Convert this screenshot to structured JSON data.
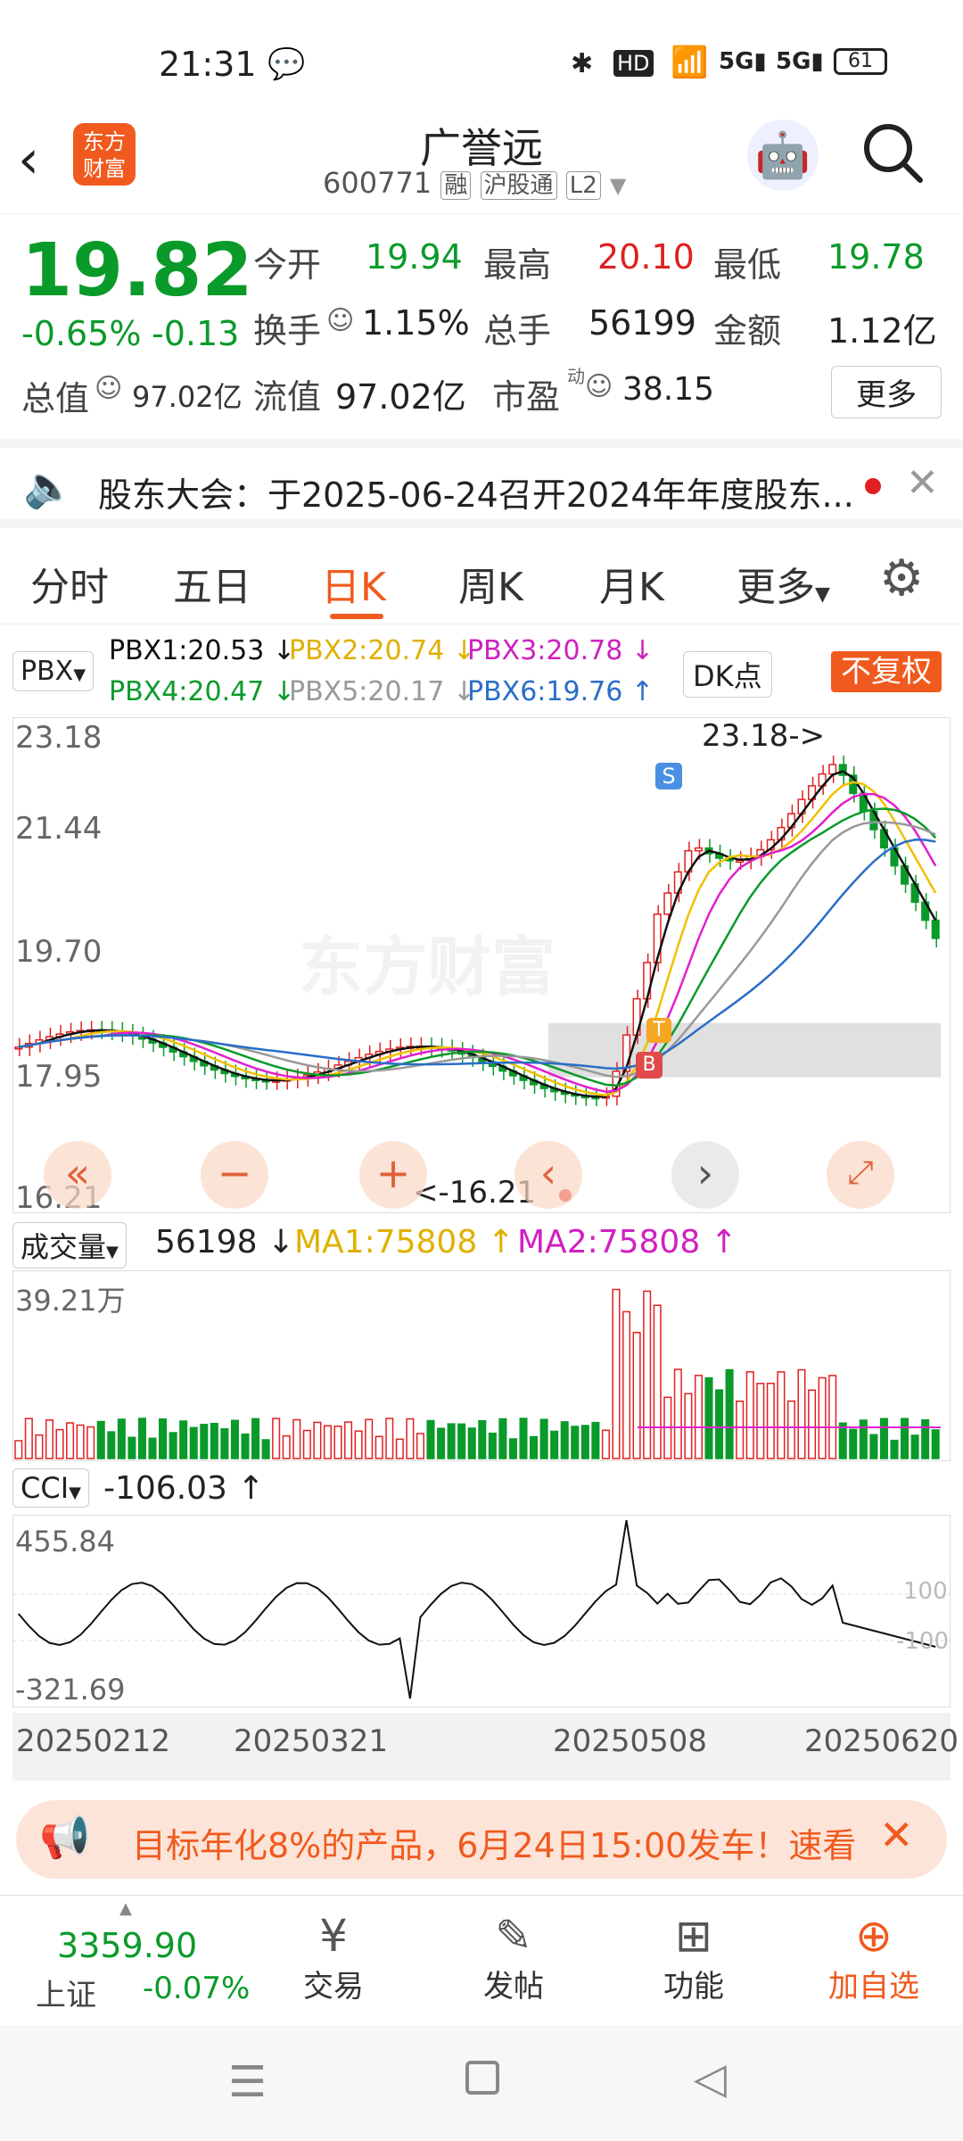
{
  "status_bar": {
    "time": "21:31",
    "battery": "61"
  },
  "header": {
    "app_logo_lines": [
      "东方",
      "财富"
    ],
    "stock_name": "广誉远",
    "stock_code": "600771",
    "badges": [
      "融",
      "沪股通",
      "L2"
    ]
  },
  "quote": {
    "price": "19.82",
    "change_pct": "-0.65%",
    "change_amt": "-0.13",
    "open_label": "今开",
    "open": "19.94",
    "high_label": "最高",
    "high": "20.10",
    "low_label": "最低",
    "low": "19.78",
    "turnover_label": "换手",
    "turnover": "1.15%",
    "volume_label": "总手",
    "volume": "56199",
    "amount_label": "金额",
    "amount": "1.12亿",
    "mktcap_label": "总值",
    "mktcap": "97.02亿",
    "float_label": "流值",
    "float": "97.02亿",
    "pe_label": "市盈",
    "pe_sup": "动",
    "pe": "38.15",
    "more_label": "更多"
  },
  "notice": {
    "text": "股东大会：于2025-06-24召开2024年年度股东..."
  },
  "tabs": [
    "分时",
    "五日",
    "日K",
    "周K",
    "月K",
    "更多"
  ],
  "active_tab": "日K",
  "kline": {
    "indicator": "PBX",
    "pbx1": "PBX1:20.53",
    "pbx2": "PBX2:20.74",
    "pbx3": "PBX3:20.78",
    "pbx4": "PBX4:20.47",
    "pbx5": "PBX5:20.17",
    "pbx6": "PBX6:19.76",
    "dk_label": "DK点",
    "fq_label": "不复权",
    "y_labels": [
      "23.18",
      "21.44",
      "19.70",
      "17.95",
      "16.21"
    ],
    "max_label": "23.18->",
    "min_label": "<-16.21",
    "markers": [
      "S",
      "T",
      "B"
    ],
    "watermark": "东方财富"
  },
  "volume": {
    "indicator": "成交量",
    "value": "56198",
    "ma1": "MA1:75808",
    "ma2": "MA2:75808",
    "ymax": "39.21万"
  },
  "cci": {
    "indicator": "CCI",
    "value": "-106.03",
    "ymax": "455.84",
    "ymin": "-321.69",
    "line_hi": "100",
    "line_lo": "-100"
  },
  "dates": [
    "20250212",
    "20250321",
    "20250508",
    "20250620"
  ],
  "ad": {
    "text": "目标年化8%的产品，6月24日15:00发车！速看"
  },
  "bottom_nav": {
    "index_value": "3359.90",
    "index_name": "上证",
    "index_change": "-0.07%",
    "items": [
      "交易",
      "发帖",
      "功能",
      "加自选"
    ]
  },
  "colors": {
    "up": "#e02020",
    "down": "#0a9a2a",
    "accent": "#f05a1e",
    "pbx1": "#111111",
    "pbx2": "#f0c000",
    "pbx3": "#e020d0",
    "pbx4": "#0a9a2a",
    "pbx5": "#999999",
    "pbx6": "#2a6ec8"
  }
}
